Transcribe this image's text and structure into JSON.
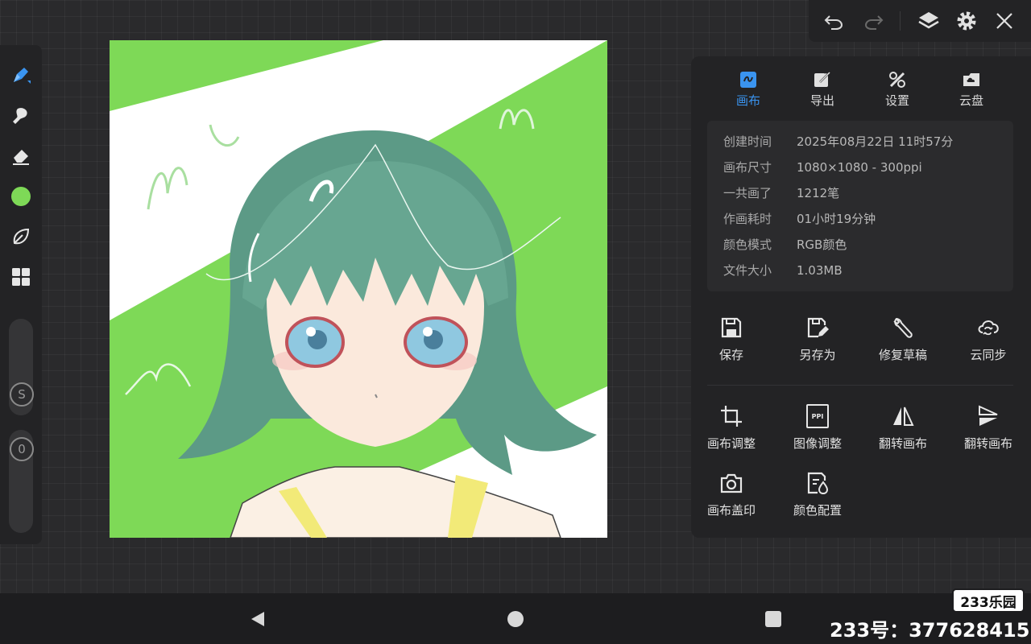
{
  "top_toolbar": {
    "icons": [
      "undo-icon",
      "redo-icon",
      "layers-icon",
      "settings-gear-icon",
      "close-icon"
    ]
  },
  "left_toolbar": {
    "tools": [
      "brush-tool-icon",
      "smudge-tool-icon",
      "eraser-tool-icon",
      "color-swatch",
      "leaf-brush-icon",
      "grid-apps-icon"
    ],
    "active_color": "#7ed957",
    "size_slider_label": "S",
    "opacity_slider_label": "0"
  },
  "canvas": {
    "colors": {
      "green": "#7ed957",
      "white": "#ffffff",
      "hair": "#5c9a86",
      "skin": "#fae8dc",
      "eye": "#8fc8e0"
    }
  },
  "panel": {
    "tabs": [
      {
        "label": "画布",
        "icon": "canvas-icon",
        "active": true
      },
      {
        "label": "导出",
        "icon": "export-icon",
        "active": false
      },
      {
        "label": "设置",
        "icon": "tools-icon",
        "active": false
      },
      {
        "label": "云盘",
        "icon": "cloud-drive-icon",
        "active": false
      }
    ],
    "info": [
      {
        "key": "创建时间",
        "value": "2025年08月22日 11时57分"
      },
      {
        "key": "画布尺寸",
        "value": "1080×1080 - 300ppi"
      },
      {
        "key": "一共画了",
        "value": "1212笔"
      },
      {
        "key": "作画耗时",
        "value": "01小时19分钟"
      },
      {
        "key": "颜色模式",
        "value": "RGB颜色"
      },
      {
        "key": "文件大小",
        "value": "1.03MB"
      }
    ],
    "actions_row1": [
      {
        "label": "保存",
        "icon": "save-icon"
      },
      {
        "label": "另存为",
        "icon": "save-as-icon"
      },
      {
        "label": "修复草稿",
        "icon": "repair-wrench-icon"
      },
      {
        "label": "云同步",
        "icon": "cloud-sync-icon"
      }
    ],
    "actions_row2": [
      {
        "label": "画布调整",
        "icon": "crop-icon"
      },
      {
        "label": "图像调整",
        "icon": "ppi-icon",
        "icon_text": "PPI"
      },
      {
        "label": "翻转画布",
        "icon": "flip-horizontal-icon"
      },
      {
        "label": "翻转画布",
        "icon": "flip-vertical-icon"
      }
    ],
    "actions_row3": [
      {
        "label": "画布盖印",
        "icon": "camera-stamp-icon"
      },
      {
        "label": "颜色配置",
        "icon": "color-profile-icon"
      }
    ],
    "accent_color": "#3a94f0"
  },
  "nav_bar": {
    "icons": [
      "back-triangle-icon",
      "home-circle-icon",
      "recents-square-icon"
    ]
  },
  "watermark": {
    "logo": "233乐园",
    "id_text": "233号：377628415"
  }
}
